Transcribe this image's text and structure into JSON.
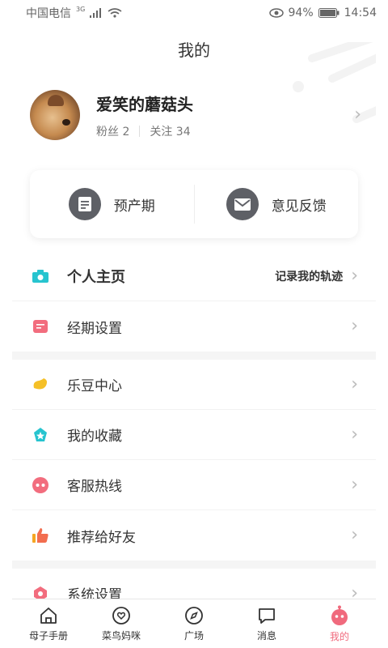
{
  "status": {
    "carrier": "中国电信",
    "network": "3G",
    "battery": "94%",
    "time": "14:54"
  },
  "header": {
    "title": "我的"
  },
  "profile": {
    "nickname": "爱笑的蘑菇头",
    "followers_label": "粉丝 2",
    "following_label": "关注 34"
  },
  "quick_actions": [
    {
      "label": "预产期",
      "icon": "calendar-icon"
    },
    {
      "label": "意见反馈",
      "icon": "mail-icon"
    }
  ],
  "menu": {
    "section1": [
      {
        "label": "个人主页",
        "right": "记录我的轨迹",
        "icon": "camera-icon",
        "color": "#27c4cf"
      },
      {
        "label": "经期设置",
        "icon": "period-icon",
        "color": "#f26d7e"
      }
    ],
    "section2": [
      {
        "label": "乐豆中心",
        "icon": "bean-icon",
        "color": "#f5c027"
      },
      {
        "label": "我的收藏",
        "icon": "favorite-icon",
        "color": "#27c4cf"
      },
      {
        "label": "客服热线",
        "icon": "service-icon",
        "color": "#f26d7e"
      },
      {
        "label": "推荐给好友",
        "icon": "thumb-up-icon",
        "color": "#f5a623"
      }
    ],
    "section3": [
      {
        "label": "系统设置",
        "icon": "settings-icon",
        "color": "#f26d7e"
      }
    ]
  },
  "tabs": [
    {
      "label": "母子手册",
      "icon": "home-icon",
      "active": false
    },
    {
      "label": "菜鸟妈咪",
      "icon": "heart-icon",
      "active": false
    },
    {
      "label": "广场",
      "icon": "compass-icon",
      "active": false
    },
    {
      "label": "消息",
      "icon": "message-icon",
      "active": false
    },
    {
      "label": "我的",
      "icon": "profile-icon",
      "active": true
    }
  ],
  "colors": {
    "accent": "#f06a7d",
    "teal": "#27c4cf",
    "gray": "#5e6066"
  }
}
